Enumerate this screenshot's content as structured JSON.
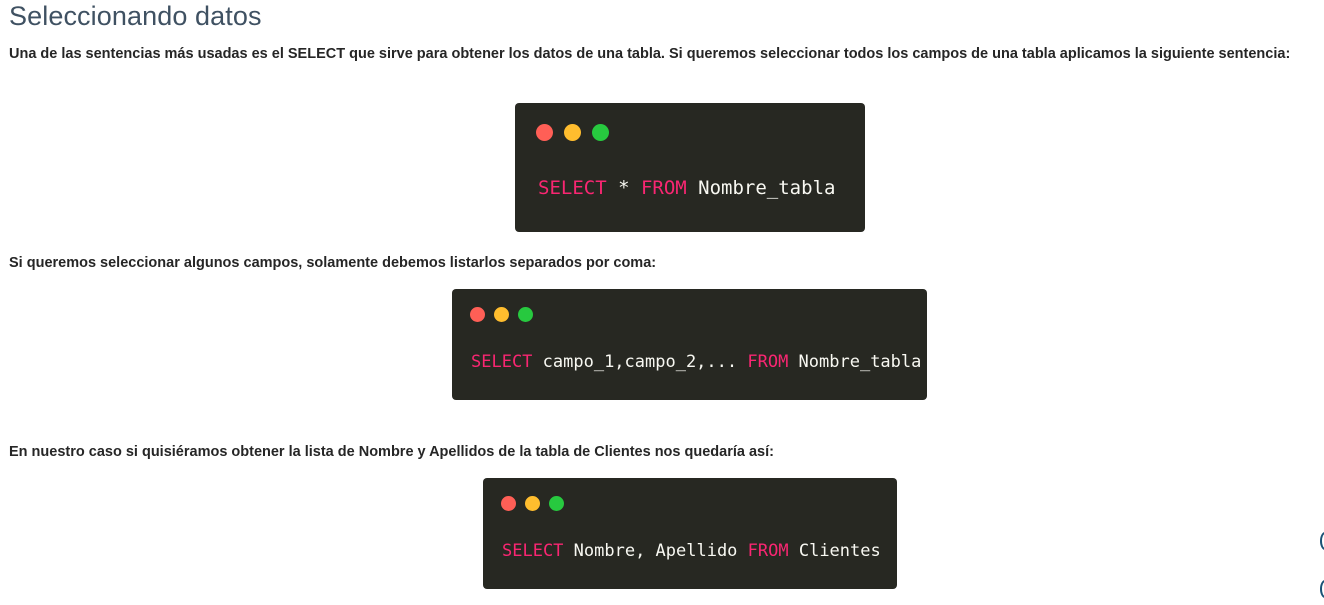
{
  "title": "Seleccionando datos",
  "paragraphs": {
    "intro": "Una de las sentencias más usadas es el SELECT que sirve para obtener los datos de una tabla. Si queremos seleccionar todos los campos de una tabla aplicamos la siguiente sentencia:",
    "some_fields": "Si queremos seleccionar algunos campos, solamente debemos listarlos separados por coma:",
    "our_case": "En nuestro caso si quisiéramos obtener la lista de Nombre y Apellidos de la tabla de Clientes nos quedaría así:"
  },
  "code_blocks": [
    {
      "tokens": [
        {
          "text": "SELECT",
          "type": "keyword"
        },
        {
          "text": " * ",
          "type": "text"
        },
        {
          "text": "FROM",
          "type": "keyword"
        },
        {
          "text": " Nombre_tabla",
          "type": "text"
        }
      ]
    },
    {
      "tokens": [
        {
          "text": "SELECT",
          "type": "keyword"
        },
        {
          "text": " campo_1,campo_2,... ",
          "type": "text"
        },
        {
          "text": "FROM",
          "type": "keyword"
        },
        {
          "text": " Nombre_tabla",
          "type": "text"
        }
      ]
    },
    {
      "tokens": [
        {
          "text": "SELECT",
          "type": "keyword"
        },
        {
          "text": " Nombre, Apellido ",
          "type": "text"
        },
        {
          "text": "FROM",
          "type": "keyword"
        },
        {
          "text": " Clientes",
          "type": "text"
        }
      ]
    }
  ],
  "colors": {
    "code_background": "#272822",
    "keyword": "#f92672",
    "code_text": "#f8f8f2",
    "title": "#3f5162",
    "dot_red": "#ff5f56",
    "dot_yellow": "#ffbd2e",
    "dot_green": "#27c93f"
  },
  "icons": {
    "window_controls": [
      "close-dot-icon",
      "minimize-dot-icon",
      "maximize-dot-icon"
    ]
  }
}
